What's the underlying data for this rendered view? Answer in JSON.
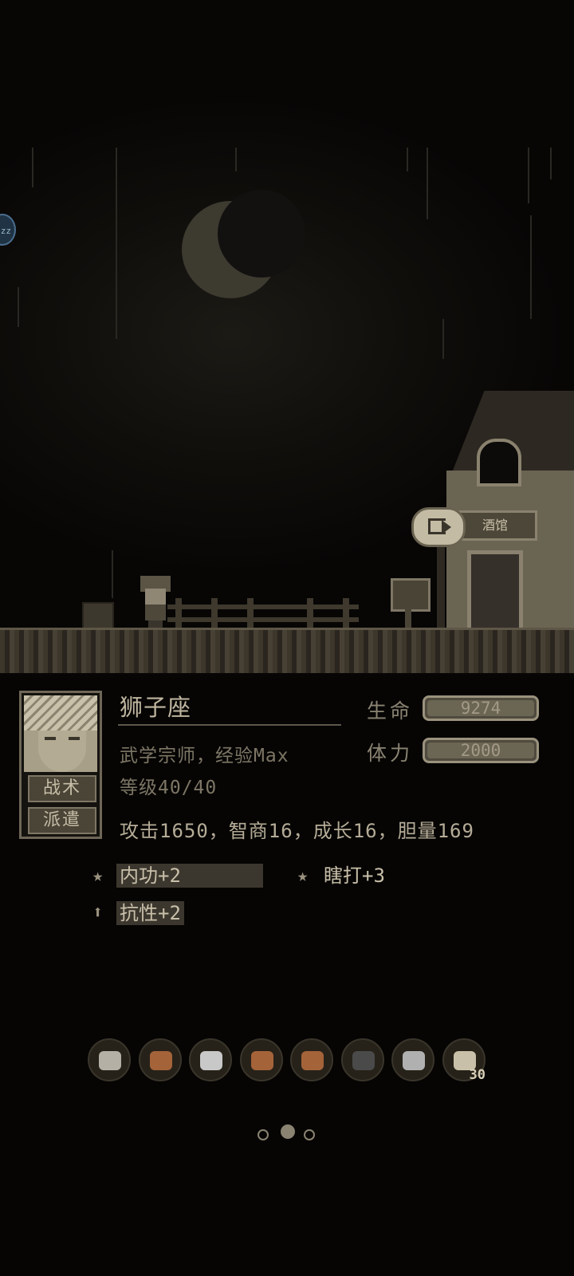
{
  "character": {
    "name": "狮子座",
    "title": "武学宗师，经验Max",
    "level": "等级40/40",
    "attributes": "攻击1650，智商16，成长16，胆量169",
    "stats": [
      {
        "label": "生命",
        "value": "9274",
        "fraction": 1.0
      },
      {
        "label": "体力",
        "value": "2000",
        "fraction": 1.0
      }
    ],
    "buttons": {
      "tactics": "战术",
      "dispatch": "派遣"
    }
  },
  "traits": [
    {
      "icon": "star-icon",
      "label": "内功+2"
    },
    {
      "icon": "star-icon",
      "label": "瞎打+3"
    },
    {
      "icon": "arrow-up-icon",
      "label": "抗性+2"
    }
  ],
  "scene": {
    "building_sign": "酒馆",
    "floating_badge": "zz"
  },
  "equipment": [
    {
      "icon": "sword-icon",
      "color": "#b5b0a6"
    },
    {
      "icon": "helmet-icon",
      "color": "#a5633a"
    },
    {
      "icon": "armor-icon",
      "color": "#c8c8c8"
    },
    {
      "icon": "gloves-icon",
      "color": "#a5633a"
    },
    {
      "icon": "boots-icon",
      "color": "#a5633a"
    },
    {
      "icon": "pants-icon",
      "color": "#4a4a4a"
    },
    {
      "icon": "necklace-icon",
      "color": "#b0b0b0"
    },
    {
      "icon": "potion-icon",
      "color": "#c8c0a8",
      "count": "30"
    }
  ],
  "pager": {
    "total": 3,
    "active": 1
  }
}
